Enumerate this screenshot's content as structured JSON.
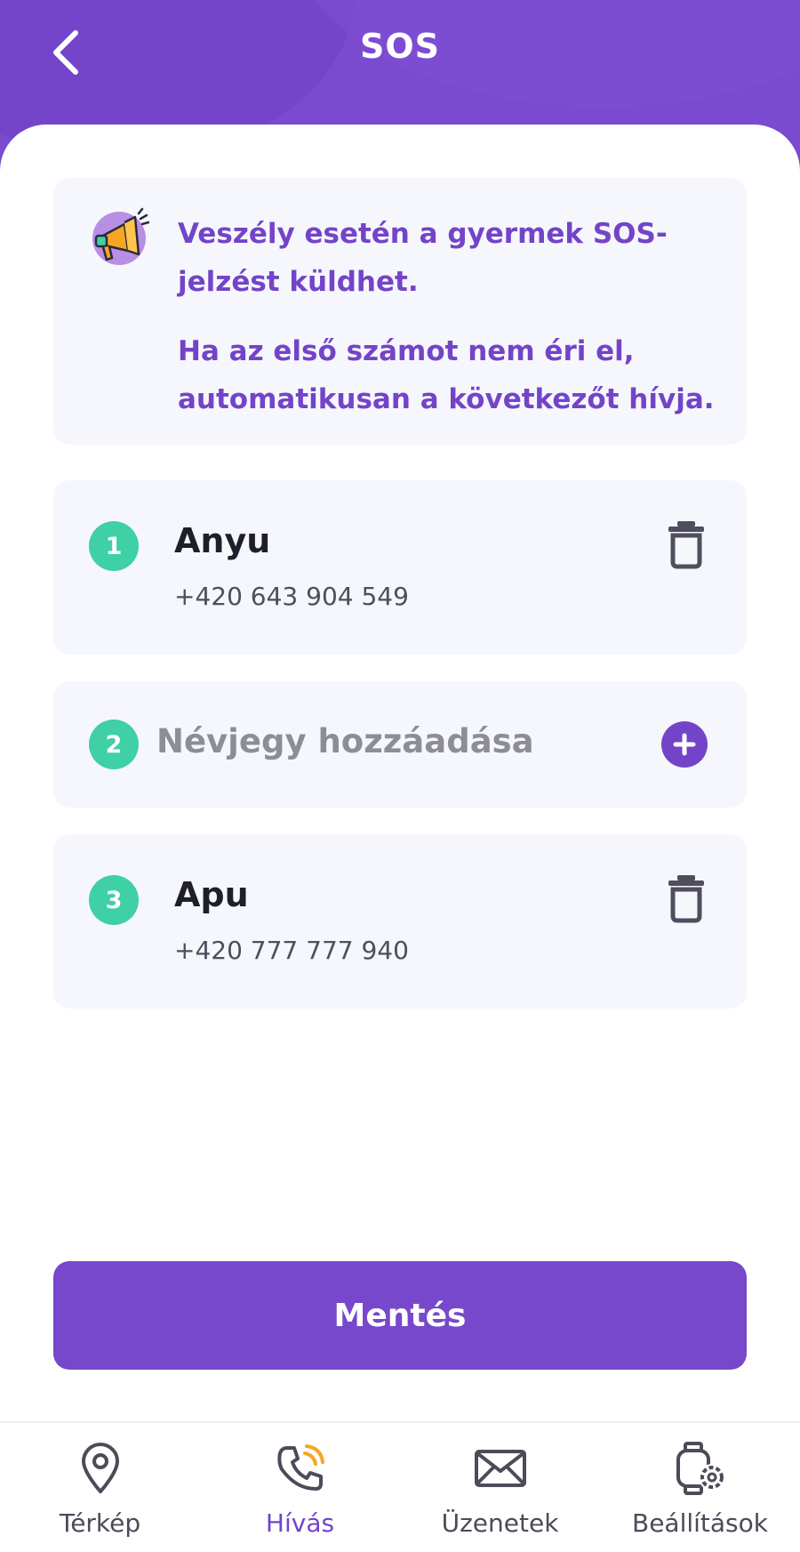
{
  "header": {
    "title": "SOS",
    "back_icon": "chevron-left-icon"
  },
  "info": {
    "icon": "megaphone-icon",
    "line1": "Veszély esetén a gyermek SOS-jelzést küldhet.",
    "line2": "Ha az első számot nem éri el, automatikusan a következőt hívja."
  },
  "contacts": [
    {
      "number": "1",
      "name": "Anyu",
      "phone": "+420 643 904 549",
      "action_icon": "trash-icon"
    },
    {
      "number": "2",
      "placeholder": "Névjegy hozzáadása",
      "action_icon": "plus-circle-icon"
    },
    {
      "number": "3",
      "name": "Apu",
      "phone": "+420 777 777 940",
      "action_icon": "trash-icon"
    }
  ],
  "save_label": "Mentés",
  "nav": {
    "items": [
      {
        "label": "Térkép",
        "icon": "map-pin-icon",
        "active": false
      },
      {
        "label": "Hívás",
        "icon": "phone-call-icon",
        "active": true
      },
      {
        "label": "Üzenetek",
        "icon": "envelope-icon",
        "active": false
      },
      {
        "label": "Beállítások",
        "icon": "watch-settings-icon",
        "active": false
      }
    ]
  },
  "colors": {
    "primary": "#7748cc",
    "badge": "#3fd0a5",
    "card": "#f6f7fc",
    "accent_orange": "#f6a623"
  }
}
